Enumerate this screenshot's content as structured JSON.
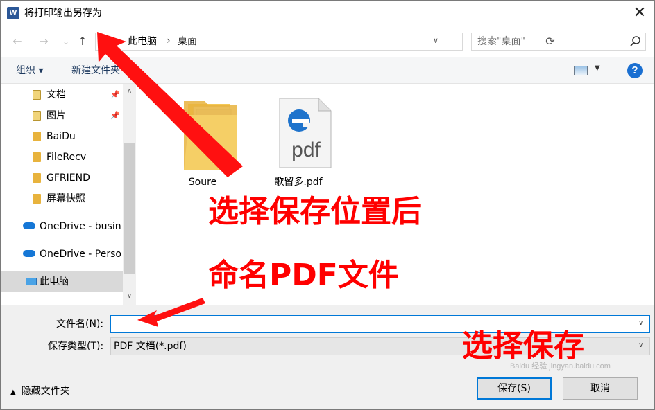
{
  "window": {
    "title": "将打印输出另存为",
    "app_badge": "W",
    "close_glyph": "✕"
  },
  "nav": {
    "back_glyph": "←",
    "forward_glyph": "→",
    "recent_glyph": "⌄",
    "up_glyph": "↑",
    "breadcrumb": [
      "此电脑",
      "桌面"
    ],
    "crumb_separator": "›",
    "search_placeholder": "搜索\"桌面\""
  },
  "toolbar": {
    "organize": "组织 ▾",
    "new_folder": "新建文件夹",
    "help": "?"
  },
  "sidebar": {
    "items": [
      {
        "label": "文档",
        "icon": "document-folder-icon",
        "pinned": true
      },
      {
        "label": "图片",
        "icon": "pictures-folder-icon",
        "pinned": true
      },
      {
        "label": "BaiDu",
        "icon": "folder-icon"
      },
      {
        "label": "FileRecv",
        "icon": "folder-icon"
      },
      {
        "label": "GFRIEND",
        "icon": "folder-icon"
      },
      {
        "label": "屏幕快照",
        "icon": "folder-icon"
      },
      {
        "label": "OneDrive - busin",
        "icon": "onedrive-icon"
      },
      {
        "label": "OneDrive - Perso",
        "icon": "onedrive-icon"
      },
      {
        "label": "此电脑",
        "icon": "this-pc-icon",
        "selected": true
      }
    ],
    "pin_glyph": "📌"
  },
  "files": [
    {
      "label": "Soure",
      "icon": "folder-icon"
    },
    {
      "label": "歌留多.pdf",
      "icon": "pdf-edge-icon",
      "icon_text": "pdf"
    }
  ],
  "form": {
    "filename_label": "文件名(N):",
    "filename_value": "",
    "filetype_label": "保存类型(T):",
    "filetype_value": "PDF 文档(*.pdf)",
    "hide_folders": "隐藏文件夹",
    "hide_glyph": "▲",
    "save": "保存(S)",
    "cancel": "取消",
    "dropdown_glyph": "∨"
  },
  "annotations": {
    "location": "选择保存位置后",
    "name": "命名PDF文件",
    "save": "选择保存"
  },
  "watermark": "Baidu 经验  jingyan.baidu.com",
  "colors": {
    "annotation": "#ff0000",
    "accent": "#0078d7",
    "help": "#1a6fd1",
    "folder": "#e8b33d"
  }
}
